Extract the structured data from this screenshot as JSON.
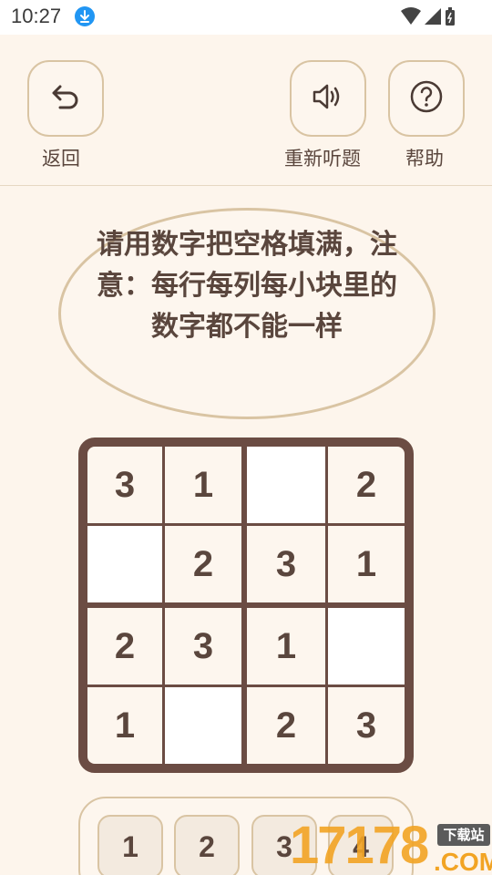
{
  "status_bar": {
    "time": "10:27"
  },
  "header": {
    "back_label": "返回",
    "replay_label": "重新听题",
    "help_label": "帮助"
  },
  "prompt": {
    "text": "请用数字把空格填满，注意：每行每列每小块里的数字都不能一样"
  },
  "board": {
    "rows": [
      [
        "3",
        "1",
        "",
        "2"
      ],
      [
        "",
        "2",
        "3",
        "1"
      ],
      [
        "2",
        "3",
        "1",
        ""
      ],
      [
        "1",
        "",
        "2",
        "3"
      ]
    ]
  },
  "keypad": {
    "keys": [
      "1",
      "2",
      "3",
      "4"
    ]
  },
  "watermark": {
    "brand": "17178",
    "badge": "下载站",
    "suffix": ".COM"
  },
  "colors": {
    "background": "#fdf5ec",
    "border": "#d9c4a3",
    "board": "#6b4c43",
    "text": "#5a463d"
  },
  "icons": {
    "back": "undo-arrow-icon",
    "replay": "speaker-icon",
    "help": "question-circle-icon",
    "download": "download-icon",
    "wifi": "wifi-icon",
    "signal": "signal-icon",
    "battery": "battery-icon"
  }
}
